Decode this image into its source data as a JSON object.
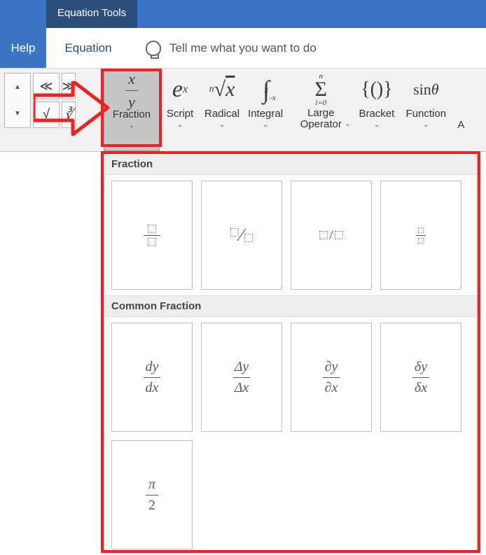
{
  "titlebar": {
    "context_tab": "Equation Tools"
  },
  "tabs": {
    "help": "Help",
    "equation": "Equation"
  },
  "tellme": {
    "placeholder": "Tell me what you want to do"
  },
  "symbols": {
    "ll": "≪",
    "gg": "≫",
    "sqrt": "√",
    "cubert": "∛"
  },
  "structures": {
    "fraction": {
      "label": "Fraction",
      "icon_num": "x",
      "icon_den": "y"
    },
    "script": {
      "label": "Script",
      "icon": "eˣ"
    },
    "radical": {
      "label": "Radical",
      "icon": "ⁿ√x"
    },
    "integral": {
      "label": "Integral",
      "icon": "∫"
    },
    "large_op": {
      "label": "Large Operator",
      "icon": "Σ"
    },
    "bracket": {
      "label": "Bracket",
      "icon": "{()}"
    },
    "function": {
      "label": "Function",
      "icon": "sin θ"
    },
    "accent_initial": "A"
  },
  "gallery": {
    "section1": "Fraction",
    "section2": "Common Fraction",
    "common": {
      "dydx_n": "dy",
      "dydx_d": "dx",
      "Dydx_n": "Δy",
      "Dydx_d": "Δx",
      "pydx_n": "∂y",
      "pydx_d": "∂x",
      "ddydx_n": "δy",
      "ddydx_d": "δx",
      "pi_n": "π",
      "pi_d": "2"
    }
  }
}
